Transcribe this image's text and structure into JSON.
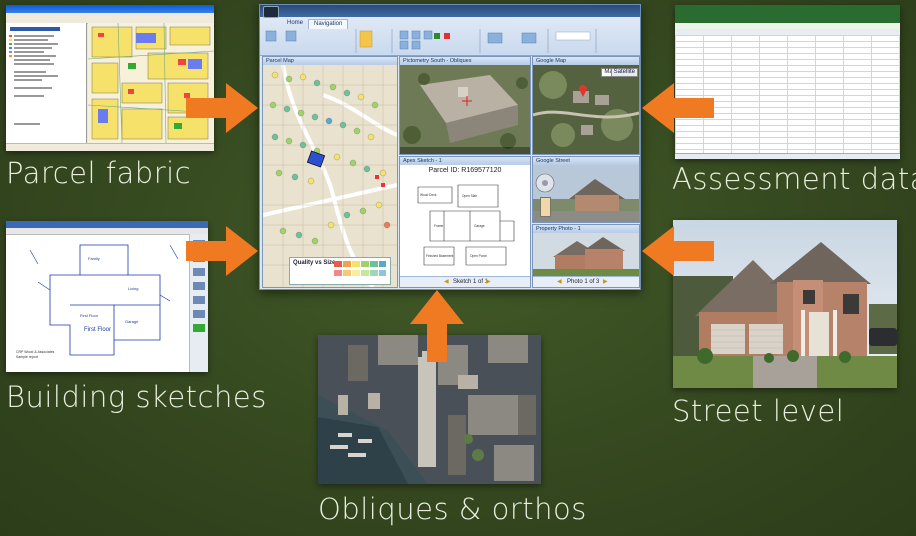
{
  "captions": {
    "parcel_fabric": "Parcel fabric",
    "assessment_data": "Assessment data",
    "building_sketches": "Building sketches",
    "street_level": "Street level",
    "obliques_orthos": "Obliques & orthos"
  },
  "app": {
    "tabs": [
      "Home",
      "Navigation"
    ],
    "panes": {
      "map": "Parcel Map",
      "oblique": "Pictometry South - Obliques",
      "google_map": "Google Map",
      "apex_sketch": "Apex Sketch - 1",
      "street": "Google Street",
      "photo": "Property Photo - 1"
    },
    "parcel_id": "Parcel ID: R169577120",
    "legend_title": "Quality vs Size",
    "sketch_nav": "Sketch 1 of 1",
    "photo_nav": "Photo 1 of 3",
    "map_toggle": [
      "Map",
      "Satellite"
    ]
  },
  "colors": {
    "background": "#364821",
    "arrow": "#ef7a22",
    "caption_text": "#e9eedf"
  }
}
